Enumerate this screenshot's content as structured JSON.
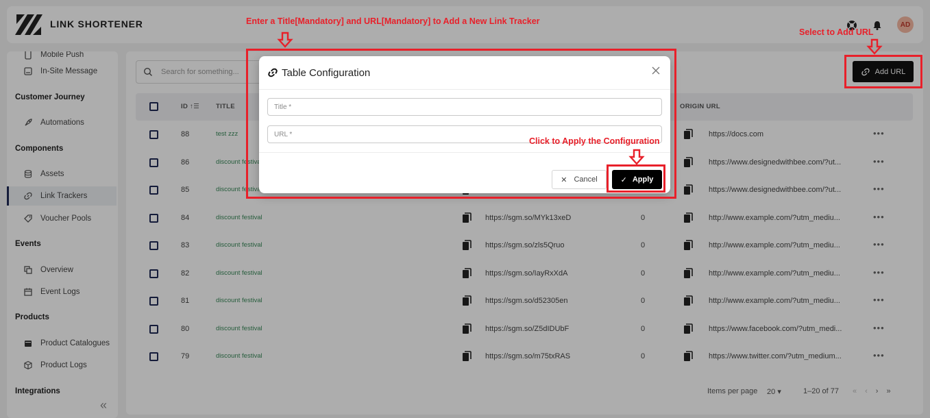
{
  "app": {
    "brand": "LINK SHORTENER",
    "avatar_initials": "AD"
  },
  "sidebar": {
    "partial_top_item": "Mobile Push",
    "items": [
      {
        "type": "item",
        "label": "In-Site Message",
        "icon": "message-icon"
      },
      {
        "type": "heading",
        "label": "Customer Journey"
      },
      {
        "type": "item",
        "label": "Automations",
        "icon": "rocket-icon"
      },
      {
        "type": "heading",
        "label": "Components"
      },
      {
        "type": "item",
        "label": "Assets",
        "icon": "database-icon"
      },
      {
        "type": "item",
        "label": "Link Trackers",
        "icon": "link-icon",
        "active": true
      },
      {
        "type": "item",
        "label": "Voucher Pools",
        "icon": "tag-icon"
      },
      {
        "type": "heading",
        "label": "Events"
      },
      {
        "type": "item",
        "label": "Overview",
        "icon": "layers-icon"
      },
      {
        "type": "item",
        "label": "Event Logs",
        "icon": "calendar-icon"
      },
      {
        "type": "heading",
        "label": "Products"
      },
      {
        "type": "item",
        "label": "Product Catalogues",
        "icon": "folder-icon"
      },
      {
        "type": "item",
        "label": "Product Logs",
        "icon": "box-icon"
      },
      {
        "type": "heading",
        "label": "Integrations"
      }
    ]
  },
  "toolbar": {
    "search_placeholder": "Search for something...",
    "add_url_label": "Add URL"
  },
  "table": {
    "headers": {
      "id": "ID",
      "title": "TITLE",
      "origin_url": "ORIGIN URL"
    },
    "rows": [
      {
        "id": "88",
        "title": "test zzz",
        "short_url": "",
        "clicks": "",
        "origin_url": "https://docs.com"
      },
      {
        "id": "86",
        "title": "discount festival",
        "short_url": "",
        "clicks": "",
        "origin_url": "https://www.designedwithbee.com/?ut..."
      },
      {
        "id": "85",
        "title": "discount festival",
        "short_url": "",
        "clicks": "",
        "origin_url": "https://www.designedwithbee.com/?ut..."
      },
      {
        "id": "84",
        "title": "discount festival",
        "short_url": "https://sgm.so/MYk13xeD",
        "clicks": "0",
        "origin_url": "http://www.example.com/?utm_mediu..."
      },
      {
        "id": "83",
        "title": "discount festival",
        "short_url": "https://sgm.so/zls5Qruo",
        "clicks": "0",
        "origin_url": "http://www.example.com/?utm_mediu..."
      },
      {
        "id": "82",
        "title": "discount festival",
        "short_url": "https://sgm.so/IayRxXdA",
        "clicks": "0",
        "origin_url": "http://www.example.com/?utm_mediu..."
      },
      {
        "id": "81",
        "title": "discount festival",
        "short_url": "https://sgm.so/d52305en",
        "clicks": "0",
        "origin_url": "http://www.example.com/?utm_mediu..."
      },
      {
        "id": "80",
        "title": "discount festival",
        "short_url": "https://sgm.so/Z5dIDUbF",
        "clicks": "0",
        "origin_url": "https://www.facebook.com/?utm_medi..."
      },
      {
        "id": "79",
        "title": "discount festival",
        "short_url": "https://sgm.so/m75txRAS",
        "clicks": "0",
        "origin_url": "https://www.twitter.com/?utm_medium..."
      }
    ]
  },
  "pagination": {
    "items_per_page_label": "Items per page",
    "page_size": "20",
    "range": "1–20 of 77"
  },
  "modal": {
    "title": "Table Configuration",
    "title_placeholder": "Title *",
    "url_placeholder": "URL *",
    "cancel_label": "Cancel",
    "apply_label": "Apply"
  },
  "annotations": {
    "enter_title": "Enter a Title[Mandatory] and URL[Mandatory] to Add a New Link Tracker",
    "select_add": "Select to Add URL",
    "apply_hint": "Click to Apply the Configuration",
    "color": "#e8202a"
  }
}
